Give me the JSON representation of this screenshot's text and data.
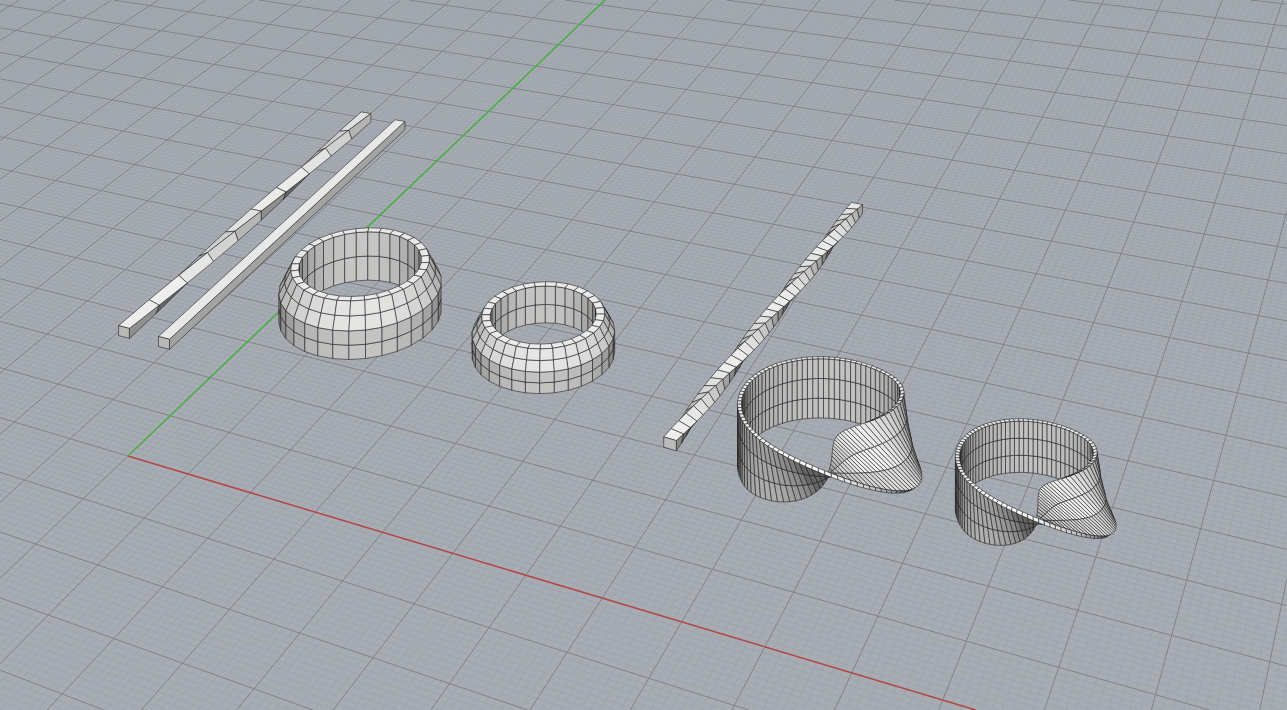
{
  "viewport": {
    "grid": true,
    "axes": true,
    "objects": [
      {
        "kind": "twisted-bar",
        "selected": false
      },
      {
        "kind": "bar",
        "selected": false
      },
      {
        "kind": "ring",
        "selected": false
      },
      {
        "kind": "ring",
        "selected": false
      },
      {
        "kind": "twisted-bar",
        "selected": false
      },
      {
        "kind": "twisted-ring",
        "selected": false
      },
      {
        "kind": "twisted-ring",
        "selected": false
      }
    ]
  }
}
